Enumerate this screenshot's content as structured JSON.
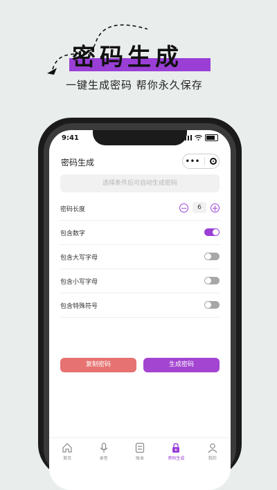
{
  "promo": {
    "title": "密码生成",
    "subtitle": "一键生成密码 帮你永久保存"
  },
  "status": {
    "time": "9:41"
  },
  "nav": {
    "title": "密码生成",
    "capsule_more": "•••"
  },
  "result": {
    "placeholder": "选择条件后可自动生成密码"
  },
  "options": {
    "length_label": "密码长度",
    "length_value": "6",
    "rows": [
      {
        "label": "包含数字",
        "enabled": true
      },
      {
        "label": "包含大写字母",
        "enabled": false
      },
      {
        "label": "包含小写字母",
        "enabled": false
      },
      {
        "label": "包含特殊符号",
        "enabled": false
      }
    ]
  },
  "actions": {
    "copy_label": "复制密码",
    "generate_label": "生成密码"
  },
  "tabbar": {
    "items": [
      {
        "label": "首页",
        "icon": "home-icon",
        "active": false
      },
      {
        "label": "录音",
        "icon": "mic-icon",
        "active": false
      },
      {
        "label": "账本",
        "icon": "ledger-icon",
        "active": false
      },
      {
        "label": "密码生成",
        "icon": "lock-icon",
        "active": true
      },
      {
        "label": "我的",
        "icon": "user-icon",
        "active": false
      }
    ]
  },
  "colors": {
    "accent": "#9a3fd6",
    "copy_button": "#e67371",
    "generate_button": "#a345d0",
    "background": "#e9eeec"
  }
}
